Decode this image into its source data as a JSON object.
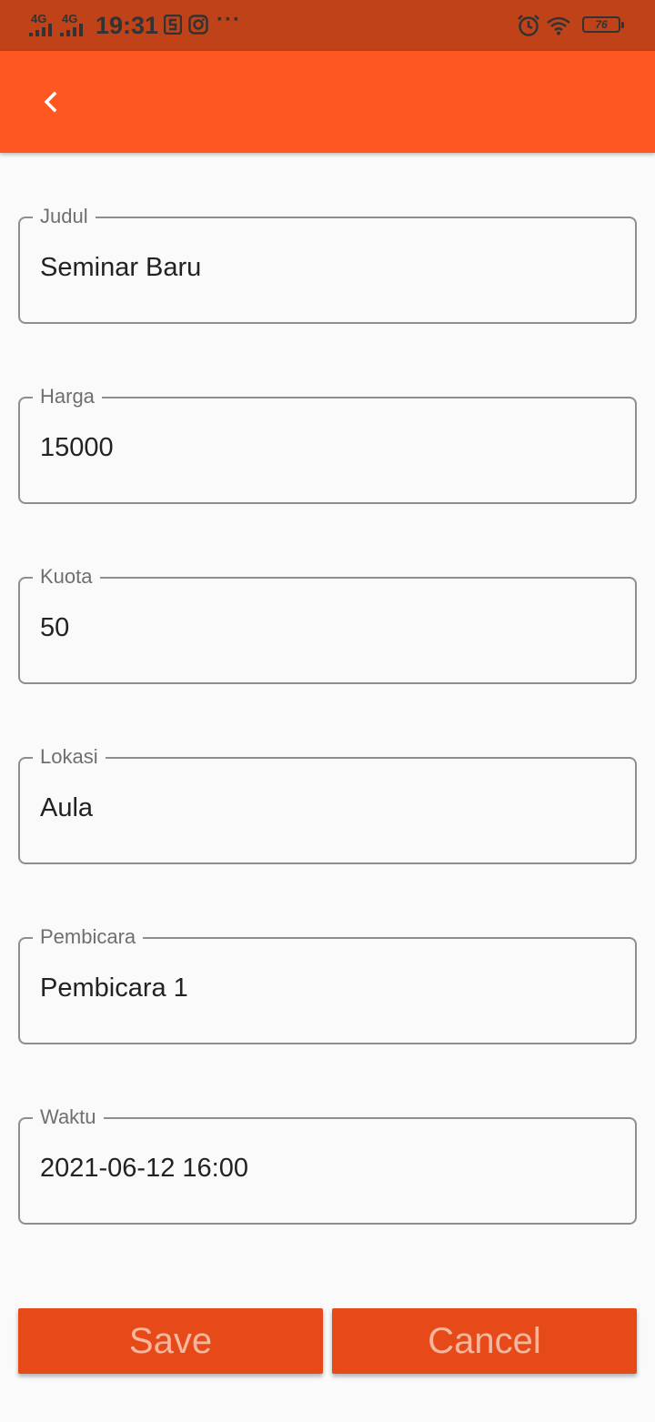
{
  "status_bar": {
    "network_1": "4G",
    "network_2": "4G",
    "time": "19:31",
    "more": "···",
    "battery": "76"
  },
  "colors": {
    "status_bar": "#bf4219",
    "app_bar": "#ff5722",
    "button": "#e64a19",
    "button_text": "#f7b79e",
    "field_border": "#8e8e8e",
    "background": "#fafafa"
  },
  "app_bar": {
    "back_icon": "chevron-left-icon"
  },
  "form": {
    "judul": {
      "label": "Judul",
      "value": "Seminar Baru"
    },
    "harga": {
      "label": "Harga",
      "value": "15000"
    },
    "kuota": {
      "label": "Kuota",
      "value": "50"
    },
    "lokasi": {
      "label": "Lokasi",
      "value": "Aula"
    },
    "pembicara": {
      "label": "Pembicara",
      "value": "Pembicara 1"
    },
    "waktu": {
      "label": "Waktu",
      "value": "2021-06-12 16:00"
    }
  },
  "actions": {
    "save_label": "Save",
    "cancel_label": "Cancel"
  }
}
